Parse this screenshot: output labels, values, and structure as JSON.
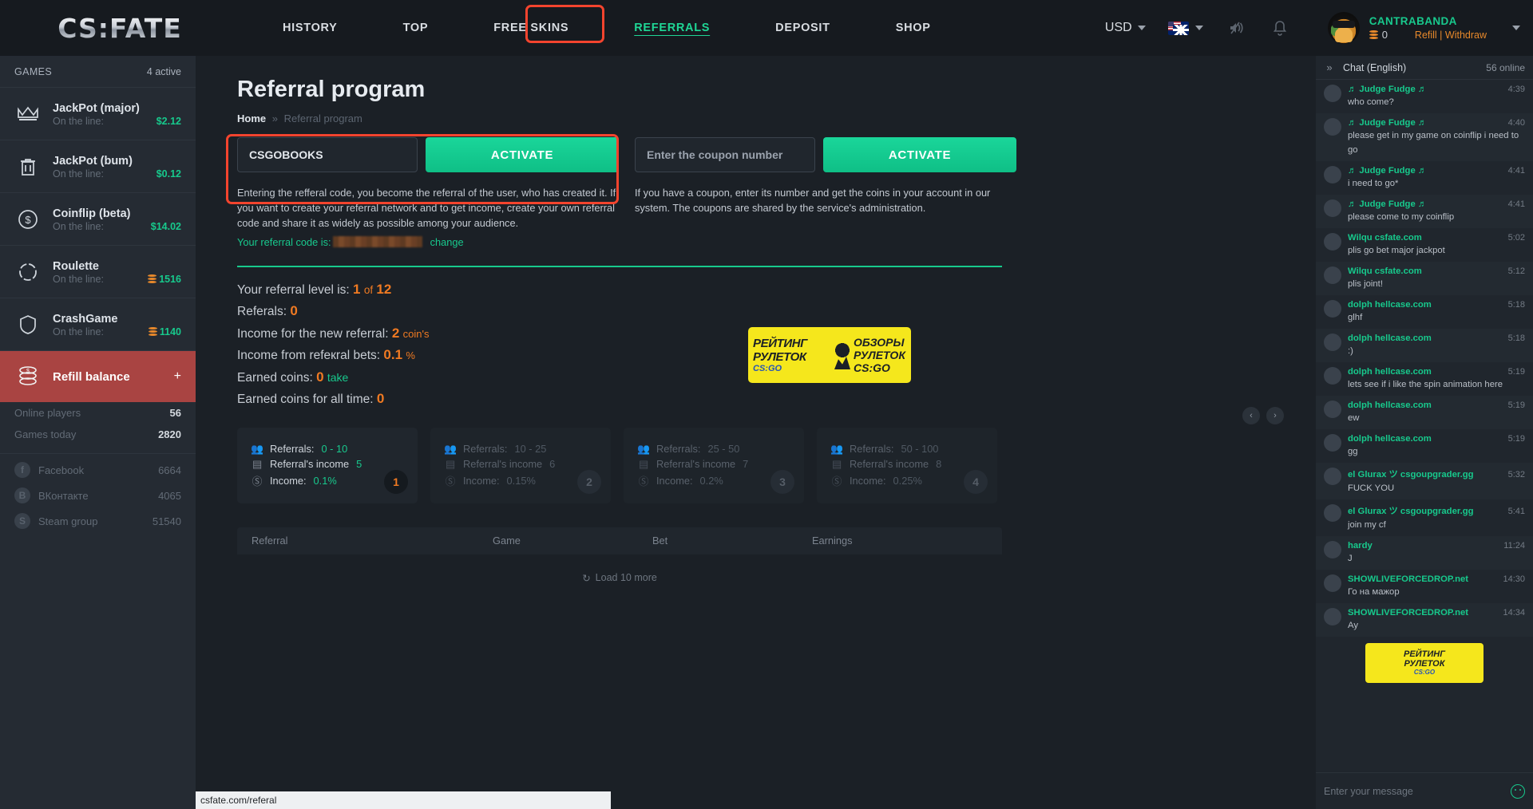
{
  "brand": {
    "name": "CS:FATE"
  },
  "nav": {
    "items": [
      {
        "label": "HISTORY",
        "active": false
      },
      {
        "label": "TOP",
        "active": false
      },
      {
        "label": "FREE SKINS",
        "active": false
      },
      {
        "label": "REFERRALS",
        "active": true
      },
      {
        "label": "DEPOSIT",
        "active": false
      },
      {
        "label": "SHOP",
        "active": false
      }
    ],
    "highlight_color": "#f4442e"
  },
  "topbar": {
    "currency": "USD",
    "language_flag": "uk-us-flag",
    "sound_icon": "sound-muted-icon",
    "bell_icon": "bell-icon"
  },
  "user": {
    "name": "CANTRABANDA",
    "balance": "0",
    "links": "Refill | Withdraw"
  },
  "sidebar": {
    "header": {
      "title": "GAMES",
      "active": "4 active"
    },
    "games": [
      {
        "name": "JackPot (major)",
        "line_label": "On the line:",
        "value": "$2.12",
        "icon": "crown-icon",
        "coin": false
      },
      {
        "name": "JackPot (bum)",
        "line_label": "On the line:",
        "value": "$0.12",
        "icon": "trash-icon",
        "coin": false
      },
      {
        "name": "Coinflip (beta)",
        "line_label": "On the line:",
        "value": "$14.02",
        "icon": "dollar-circle-icon",
        "coin": false
      },
      {
        "name": "Roulette",
        "line_label": "On the line:",
        "value": "1516",
        "icon": "roulette-icon",
        "coin": true
      },
      {
        "name": "CrashGame",
        "line_label": "On the line:",
        "value": "1140",
        "icon": "shield-icon",
        "coin": true
      }
    ],
    "refill": {
      "label": "Refill balance",
      "plus": "+"
    },
    "stats": [
      {
        "key": "Online players",
        "value": "56"
      },
      {
        "key": "Games today",
        "value": "2820"
      }
    ],
    "social": [
      {
        "name": "Facebook",
        "count": "6664",
        "glyph": "f"
      },
      {
        "name": "ВКонтакте",
        "count": "4065",
        "glyph": "В"
      },
      {
        "name": "Steam group",
        "count": "51540",
        "glyph": "S"
      }
    ]
  },
  "page": {
    "title": "Referral program",
    "breadcrumb": {
      "home": "Home",
      "sep": "»",
      "current": "Referral program"
    }
  },
  "referral_form": {
    "code_value": "CSGOBOOKS",
    "activate_label": "ACTIVATE",
    "description": "Entering the refferal code, you become the referral of the user, who has created it. If you want to create your referral network and to get income, create your own referral code and share it as widely as possible among your audience.",
    "your_code_label": "Your referral code is:",
    "change_label": "change"
  },
  "coupon_form": {
    "placeholder": "Enter the coupon number",
    "activate_label": "ACTIVATE",
    "description": "If you have a coupon, enter its number and get the coins in your account in our system. The coupons are shared by the service's administration."
  },
  "stats_block": {
    "level_label": "Your referral level is:",
    "level_value": "1",
    "level_of": "of",
    "level_max": "12",
    "referrals_label": "Referals:",
    "referrals_value": "0",
    "income_new_label": "Income for the new referral:",
    "income_new_value": "2",
    "income_new_unit": "coin's",
    "income_bets_label": "Income from refeкral bets:",
    "income_bets_value": "0.1",
    "income_bets_unit": "%",
    "earned_label": "Earned coins:",
    "earned_value": "0",
    "earned_take": "take",
    "earned_all_label": "Earned coins for all time:",
    "earned_all_value": "0"
  },
  "banner": {
    "left_l1": "РЕЙТИНГ",
    "left_l2": "РУЛЕТОК",
    "left_l3": "CS:GO",
    "right_r1": "ОБЗОРЫ",
    "right_r2": "РУЛЕТОК",
    "right_r3": "CS:GO"
  },
  "carousel": {
    "prev": "‹",
    "next": "›"
  },
  "level_cards": [
    {
      "referrals_label": "Referrals:",
      "referrals_value": "0 - 10",
      "income_label": "Referral's income",
      "income_value": "5",
      "percent_label": "Income:",
      "percent_value": "0.1%",
      "badge": "1",
      "active": true
    },
    {
      "referrals_label": "Referrals:",
      "referrals_value": "10 - 25",
      "income_label": "Referral's income",
      "income_value": "6",
      "percent_label": "Income:",
      "percent_value": "0.15%",
      "badge": "2",
      "active": false
    },
    {
      "referrals_label": "Referrals:",
      "referrals_value": "25 - 50",
      "income_label": "Referral's income",
      "income_value": "7",
      "percent_label": "Income:",
      "percent_value": "0.2%",
      "badge": "3",
      "active": false
    },
    {
      "referrals_label": "Referrals:",
      "referrals_value": "50 - 100",
      "income_label": "Referral's income",
      "income_value": "8",
      "percent_label": "Income:",
      "percent_value": "0.25%",
      "badge": "4",
      "active": false
    }
  ],
  "table": {
    "headers": [
      "Referral",
      "Game",
      "Bet",
      "Earnings"
    ],
    "load_more": "Load 10 more"
  },
  "status_bar": {
    "url": "csfate.com/referal"
  },
  "chat": {
    "title": "Chat (English)",
    "online": "56 online",
    "expand_icon": "chevron-right-double-icon",
    "input_placeholder": "Enter your message",
    "messages": [
      {
        "name": "♬ Judge Fudge ♬",
        "time": "4:39",
        "text": "who come?",
        "color": "#17c98c"
      },
      {
        "name": "♬ Judge Fudge ♬",
        "time": "4:40",
        "text": "please get in my game on coinflip i need to go",
        "color": "#17c98c"
      },
      {
        "name": "♬ Judge Fudge ♬",
        "time": "4:41",
        "text": "i need to go*",
        "color": "#17c98c"
      },
      {
        "name": "♬ Judge Fudge ♬",
        "time": "4:41",
        "text": "please come to my coinflip",
        "color": "#17c98c"
      },
      {
        "name": "Wilqu csfate.com",
        "time": "5:02",
        "text": "plis go bet major jackpot",
        "color": "#17c98c"
      },
      {
        "name": "Wilqu csfate.com",
        "time": "5:12",
        "text": "plis joint!",
        "color": "#17c98c"
      },
      {
        "name": "dolph hellcase.com",
        "time": "5:18",
        "text": "glhf",
        "color": "#17c98c"
      },
      {
        "name": "dolph hellcase.com",
        "time": "5:18",
        "text": ":)",
        "color": "#17c98c"
      },
      {
        "name": "dolph hellcase.com",
        "time": "5:19",
        "text": "lets see if i like the spin animation here",
        "color": "#17c98c"
      },
      {
        "name": "dolph hellcase.com",
        "time": "5:19",
        "text": "ew",
        "color": "#17c98c"
      },
      {
        "name": "dolph hellcase.com",
        "time": "5:19",
        "text": "gg",
        "color": "#17c98c"
      },
      {
        "name": "el Glurax ツ csgoupgrader.gg",
        "time": "5:32",
        "text": "FUCK YOU",
        "color": "#17c98c"
      },
      {
        "name": "el Glurax ツ csgoupgrader.gg",
        "time": "5:41",
        "text": "join my cf",
        "color": "#17c98c"
      },
      {
        "name": "hardy",
        "time": "11:24",
        "text": "J",
        "color": "#17c98c"
      },
      {
        "name": "SHOWLIVEFORCEDROP.net",
        "time": "14:30",
        "text": "Го на мажор",
        "color": "#17c98c"
      },
      {
        "name": "SHOWLIVEFORCEDROP.net",
        "time": "14:34",
        "text": "Ay",
        "color": "#17c98c"
      }
    ],
    "banner": {
      "l1": "РЕЙТИНГ",
      "l2": "РУЛЕТОК",
      "l3": "CS:GO"
    }
  }
}
